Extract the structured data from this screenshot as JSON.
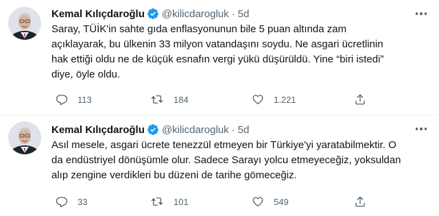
{
  "colors": {
    "verified_badge": "#1d9bf0",
    "text_primary": "#0f1419",
    "text_secondary": "#536471",
    "divider": "#eff3f4"
  },
  "tweets": [
    {
      "author_name": "Kemal Kılıçdaroğlu",
      "handle": "@kilicdarogluk",
      "separator": "·",
      "time": "5d",
      "text_lines": [
        "Saray, TÜİK'in sahte gıda enflasyonunun bile 5 puan altında zam",
        "açıklayarak, bu ülkenin 33 milyon vatandaşını soydu. Ne asgari ücretlinin",
        "hak ettiği oldu ne de küçük esnafın vergi yükü düşürüldü. Yine “biri istedi”",
        "diye, öyle oldu."
      ],
      "replies": "113",
      "retweets": "184",
      "likes": "1.221"
    },
    {
      "author_name": "Kemal Kılıçdaroğlu",
      "handle": "@kilicdarogluk",
      "separator": "·",
      "time": "5d",
      "text_lines": [
        "Asıl mesele, asgari ücrete tenezzül etmeyen bir Türkiye'yi yaratabilmektir. O",
        "da endüstriyel dönüşümle olur. Sadece Sarayı yolcu etmeyeceğiz, yoksuldan",
        "alıp zengine verdikleri bu düzeni de tarihe gömeceğiz."
      ],
      "replies": "33",
      "retweets": "101",
      "likes": "549"
    }
  ],
  "icons": {
    "avatar": "profile-photo",
    "verified": "verified-badge-icon",
    "more": "more-options-icon",
    "reply": "reply-icon",
    "retweet": "retweet-icon",
    "like": "heart-icon",
    "share": "share-icon"
  }
}
